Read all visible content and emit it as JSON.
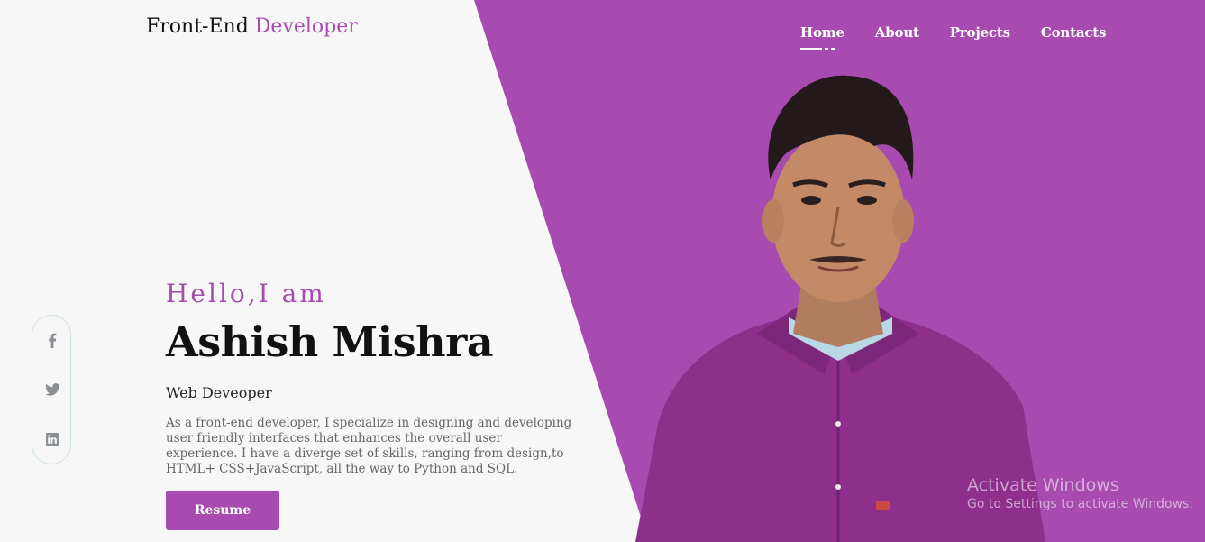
{
  "header": {
    "logo_main": "Front-End",
    "logo_accent": "Developer",
    "nav": [
      "Home",
      "About",
      "Projects",
      "Contacts"
    ]
  },
  "social": [
    "facebook-icon",
    "twitter-icon",
    "linkedin-icon"
  ],
  "hero": {
    "greeting": "Hello,I am",
    "name": "Ashish Mishra",
    "role": "Web Deveoper",
    "description": "As a front-end developer, I specialize in designing and developing user friendly interfaces that enhances the overall user experience. I have a diverge set of skills, ranging from design,to HTML+ CSS+JavaScript, all the way to Python and SQL.",
    "button": "Resume"
  },
  "watermark": {
    "title": "Activate Windows",
    "subtitle": "Go to Settings to activate Windows."
  },
  "colors": {
    "accent": "#a74bb0",
    "background": "#f7f7f7"
  }
}
